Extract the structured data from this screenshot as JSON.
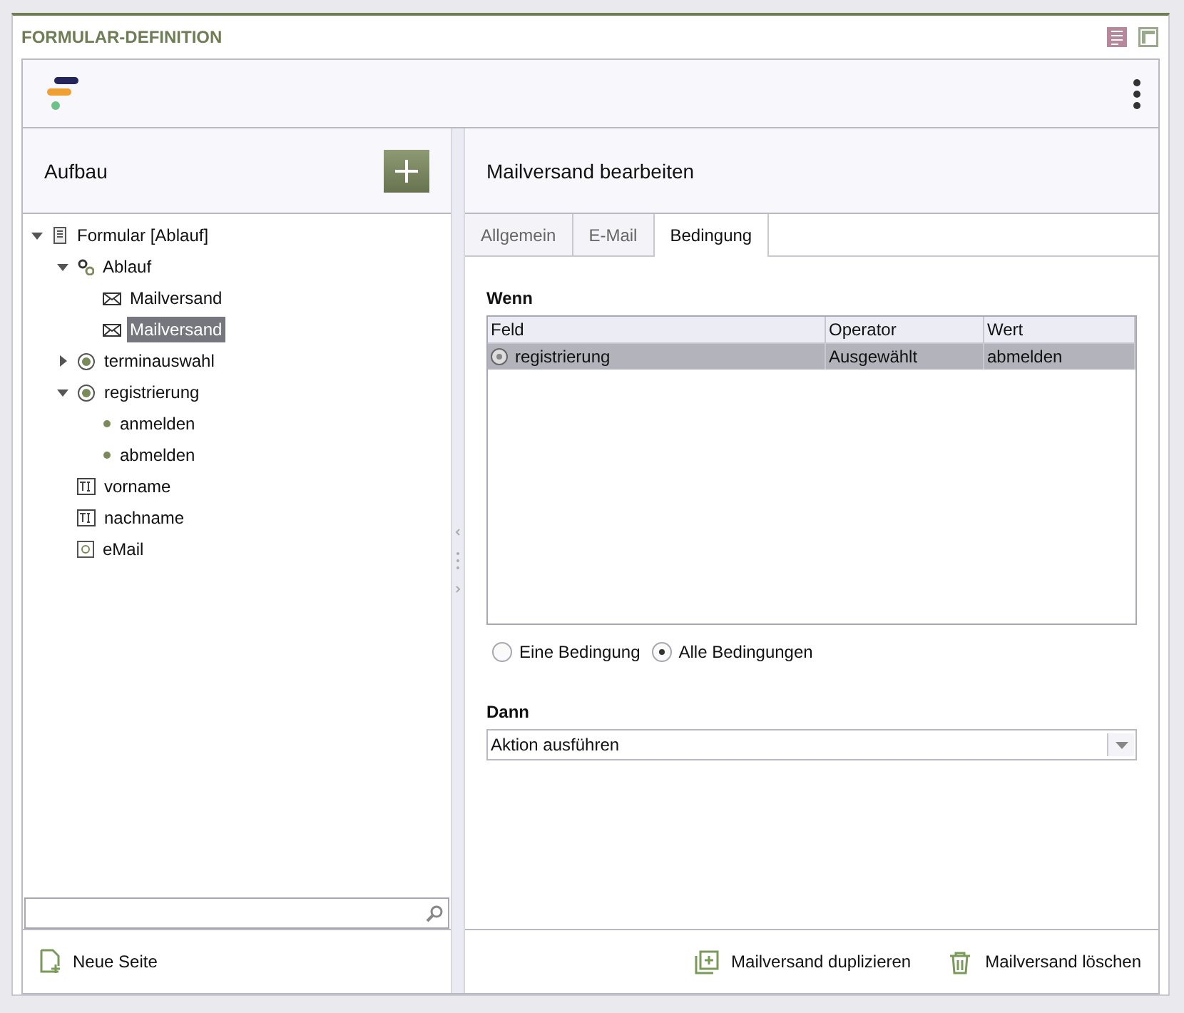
{
  "window": {
    "title": "FORMULAR-DEFINITION"
  },
  "left_panel": {
    "title": "Aufbau",
    "tree": [
      {
        "label": "Formular [Ablauf]",
        "kind": "form",
        "selected": false,
        "expanded": true,
        "children": [
          {
            "label": "Ablauf",
            "kind": "gears",
            "selected": false,
            "expanded": true,
            "children": [
              {
                "label": "Mailversand",
                "kind": "mail",
                "selected": false
              },
              {
                "label": "Mailversand",
                "kind": "mail",
                "selected": true
              }
            ]
          },
          {
            "label": "terminauswahl",
            "kind": "radio",
            "selected": false,
            "expanded": false
          },
          {
            "label": "registrierung",
            "kind": "radio",
            "selected": false,
            "expanded": true,
            "children": [
              {
                "label": "anmelden",
                "kind": "dot",
                "selected": false
              },
              {
                "label": "abmelden",
                "kind": "dot",
                "selected": false
              }
            ]
          },
          {
            "label": "vorname",
            "kind": "text",
            "selected": false
          },
          {
            "label": "nachname",
            "kind": "text",
            "selected": false
          },
          {
            "label": "eMail",
            "kind": "email",
            "selected": false
          }
        ]
      }
    ],
    "footer_button": "Neue Seite"
  },
  "right_panel": {
    "title": "Mailversand bearbeiten",
    "tabs": [
      {
        "label": "Allgemein",
        "selected": false
      },
      {
        "label": "E-Mail",
        "selected": false
      },
      {
        "label": "Bedingung",
        "selected": true
      }
    ],
    "condition_label": "Wenn",
    "table": {
      "columns": [
        "Feld",
        "Operator",
        "Wert"
      ],
      "rows": [
        {
          "cells": [
            "registrierung",
            "Ausgewählt",
            "abmelden"
          ],
          "selected": true
        }
      ]
    },
    "match_options": [
      {
        "label": "Eine Bedingung",
        "selected": false
      },
      {
        "label": "Alle Bedingungen",
        "selected": true
      }
    ],
    "action_label": "Dann",
    "action_select": "Aktion ausführen",
    "footer_buttons": [
      {
        "label": "Mailversand duplizieren",
        "kind": "duplicate"
      },
      {
        "label": "Mailversand löschen",
        "kind": "delete"
      }
    ]
  }
}
